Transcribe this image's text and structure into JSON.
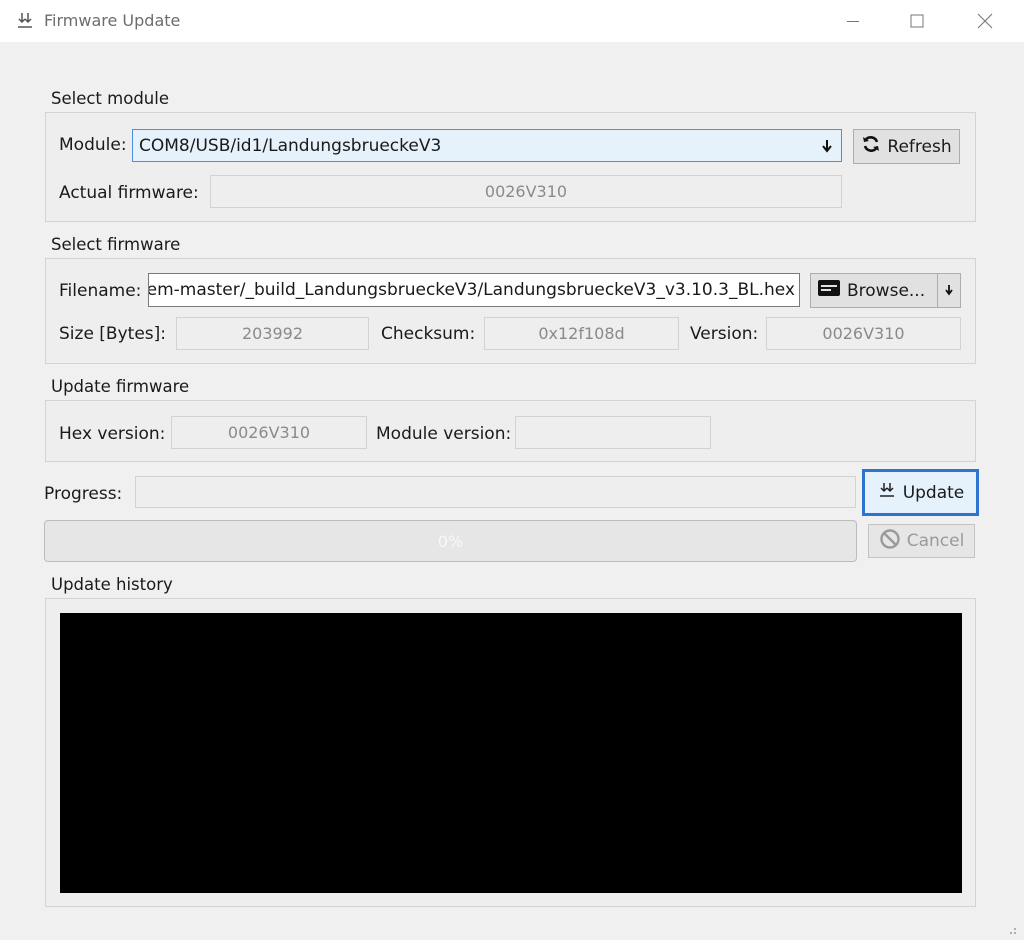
{
  "window": {
    "title": "Firmware Update",
    "app_icon": "download-icon",
    "controls": [
      "minimize-icon",
      "maximize-icon",
      "close-icon"
    ]
  },
  "select_module": {
    "group_label": "Select module",
    "module_label": "Module:",
    "module_value": "COM8/USB/id1/LandungsbrueckeV3",
    "refresh_button": "Refresh",
    "actual_firmware_label": "Actual firmware:",
    "actual_firmware_value": "0026V310"
  },
  "select_firmware": {
    "group_label": "Select firmware",
    "filename_label": "Filename:",
    "filename_value": "em-master/_build_LandungsbrueckeV3/LandungsbrueckeV3_v3.10.3_BL.hex",
    "browse_button": "Browse...",
    "size_label": "Size [Bytes]:",
    "size_value": "203992",
    "checksum_label": "Checksum:",
    "checksum_value": "0x12f108d",
    "version_label": "Version:",
    "version_value": "0026V310"
  },
  "update_firmware": {
    "group_label": "Update firmware",
    "hex_version_label": "Hex version:",
    "hex_version_value": "0026V310",
    "module_version_label": "Module version:",
    "module_version_value": ""
  },
  "progress": {
    "label": "Progress:",
    "update_button": "Update",
    "cancel_button": "Cancel",
    "percent_text": "0%",
    "fraction": 0
  },
  "history": {
    "group_label": "Update history"
  },
  "colors": {
    "console_bg": "#000000",
    "focus_accent": "#2f73d0",
    "combo_bg": "#e5f1fb"
  }
}
